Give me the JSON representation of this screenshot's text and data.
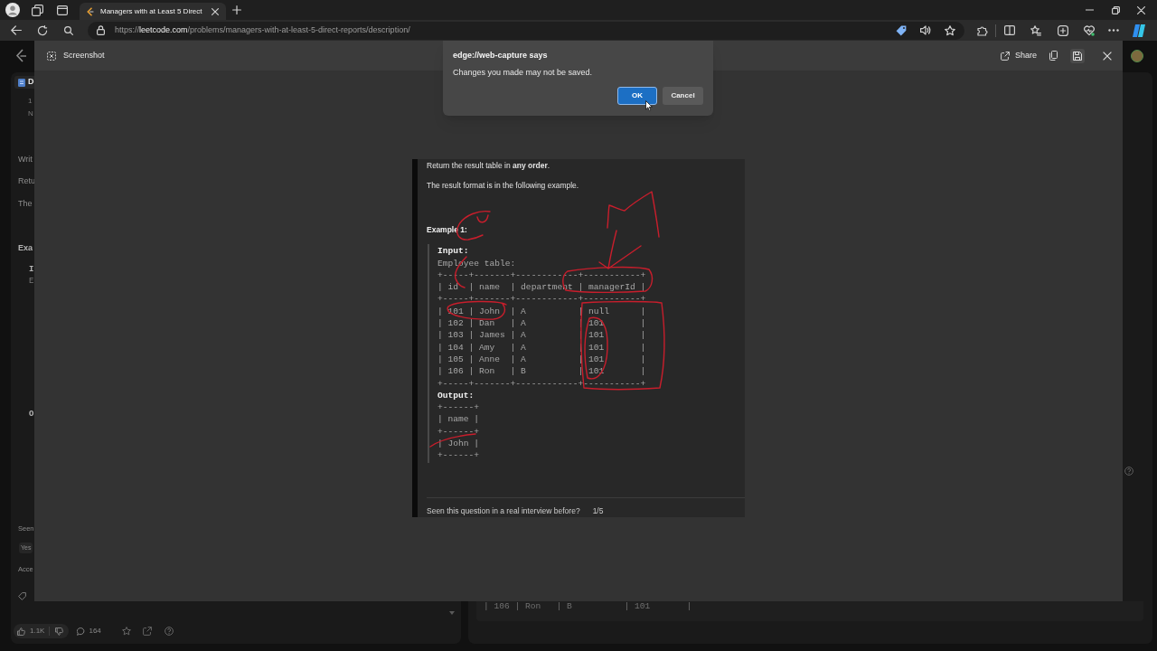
{
  "browser": {
    "tabs": [
      {
        "title": "Managers with at Least 5 Direct",
        "selected": true
      }
    ],
    "address": {
      "scheme": "https://",
      "host": "leetcode.com",
      "path": "/problems/managers-with-at-least-5-direct-reports/description/"
    }
  },
  "page": {
    "left_panel": [
      {
        "kind": "tab",
        "text": "D"
      },
      {
        "kind": "indent_faint",
        "text": "1"
      },
      {
        "kind": "indent_faint",
        "text": "N"
      },
      {
        "kind": "text",
        "text": "Writ"
      },
      {
        "kind": "text",
        "text": "Retu"
      },
      {
        "kind": "text",
        "text": "The"
      },
      {
        "kind": "bold",
        "text": "Exa"
      },
      {
        "kind": "code_bold",
        "text": "I"
      },
      {
        "kind": "code_faint",
        "text": "E"
      },
      {
        "kind": "code_bold",
        "text": "O"
      },
      {
        "kind": "muted",
        "text": "Seen"
      },
      {
        "kind": "chip",
        "text": "Yes"
      },
      {
        "kind": "muted",
        "text": "Acce"
      }
    ],
    "likes": "1.1K",
    "comments": "164",
    "console_lines": [
      "| 106 | Ron   | B          | 101       |"
    ]
  },
  "capture_tool": {
    "title": "Screenshot",
    "share": "Share"
  },
  "capture": {
    "paragraphs": [
      "Return the result table in **any order**.",
      "The result format is in the following example."
    ],
    "example_heading": "Example 1:",
    "input_label": "Input:",
    "input_caption": "Employee table:",
    "input_lines": [
      "+-----+-------+------------+-----------+",
      "| id  | name  | department | managerId |",
      "+-----+-------+------------+-----------+",
      "| 101 | John  | A          | null      |",
      "| 102 | Dan   | A          | 101       |",
      "| 103 | James | A          | 101       |",
      "| 104 | Amy   | A          | 101       |",
      "| 105 | Anne  | A          | 101       |",
      "| 106 | Ron   | B          | 101       |",
      "+-----+-------+------------+-----------+"
    ],
    "output_label": "Output:",
    "output_lines": [
      "+------+",
      "| name |",
      "+------+",
      "| John |",
      "+------+"
    ],
    "prompt": "Seen this question in a real interview before?",
    "prompt_count": "1/5"
  },
  "dialog": {
    "title": "edge://web-capture says",
    "message": "Changes you made may not be saved.",
    "buttons": [
      {
        "label": "OK",
        "kind": "primary"
      },
      {
        "label": "Cancel",
        "kind": "secondary"
      }
    ]
  }
}
